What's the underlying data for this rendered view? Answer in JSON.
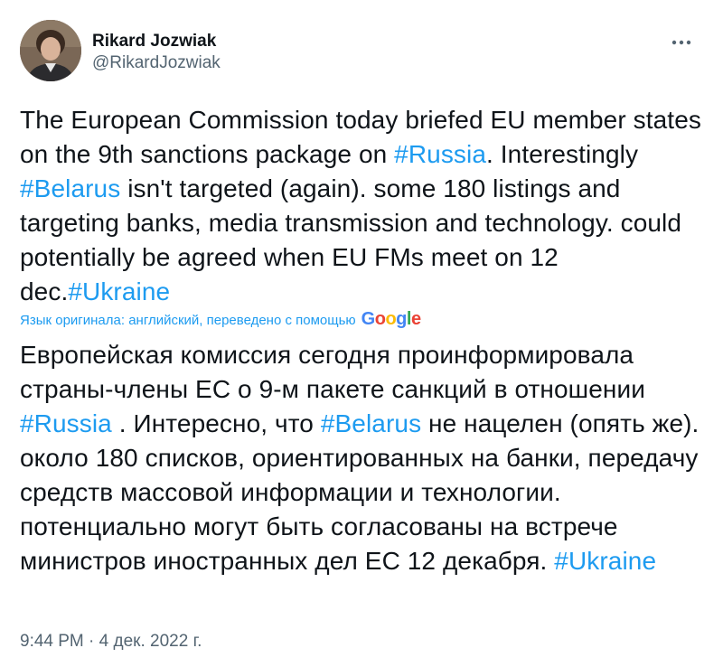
{
  "author": {
    "display_name": "Rikard Jozwiak",
    "handle": "@RikardJozwiak"
  },
  "tweet": {
    "original": {
      "seg1": "The European Commission today briefed EU member states on the 9th sanctions package on ",
      "tag1": "#Russia",
      "seg2": ". Interestingly ",
      "tag2": "#Belarus",
      "seg3": " isn't targeted (again). some 180 listings and targeting banks, media transmission and technology. could potentially be agreed when EU FMs meet on 12 dec.",
      "tag3": "#Ukraine"
    },
    "translation_notice": "Язык оригинала: английский, переведено с помощью",
    "translation_provider": "Google",
    "translated": {
      "seg1": "Европейская комиссия сегодня проинформировала страны-члены ЕС о 9-м пакете санкций в отношении ",
      "tag1": "#Russia",
      "seg2": " . Интересно, что ",
      "tag2": "#Belarus",
      "seg3": " не нацелен (опять же). около 180 списков, ориентированных на банки, передачу средств массовой информации и технологии. потенциально могут быть согласованы на встрече министров иностранных дел ЕС 12 декабря. ",
      "tag3": "#Ukraine"
    }
  },
  "meta": {
    "time": "9:44 PM",
    "separator": "·",
    "date": "4 дек. 2022 г."
  },
  "colors": {
    "link": "#1d9bf0",
    "text": "#0f1419",
    "muted": "#536471"
  },
  "icons": {
    "more": "more-horizontal-icon"
  }
}
